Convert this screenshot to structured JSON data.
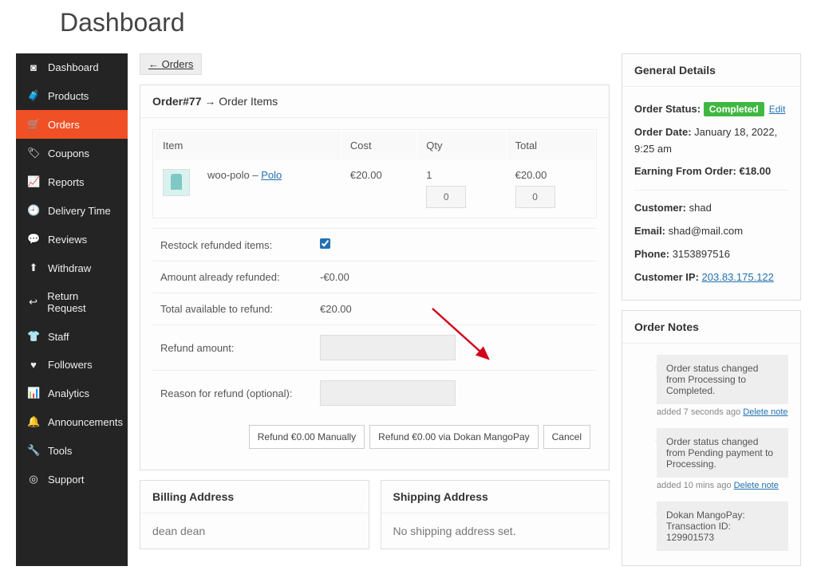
{
  "page_title": "Dashboard",
  "back_link": "← Orders",
  "sidebar": {
    "items": [
      {
        "label": "Dashboard",
        "icon": "◙"
      },
      {
        "label": "Products",
        "icon": "🧳"
      },
      {
        "label": "Orders",
        "icon": "🛒",
        "active": true
      },
      {
        "label": "Coupons",
        "icon": "🏷"
      },
      {
        "label": "Reports",
        "icon": "📈"
      },
      {
        "label": "Delivery Time",
        "icon": "🕘"
      },
      {
        "label": "Reviews",
        "icon": "💬"
      },
      {
        "label": "Withdraw",
        "icon": "⬆"
      },
      {
        "label": "Return Request",
        "icon": "↩"
      },
      {
        "label": "Staff",
        "icon": "👕"
      },
      {
        "label": "Followers",
        "icon": "♥"
      },
      {
        "label": "Analytics",
        "icon": "📊"
      },
      {
        "label": "Announcements",
        "icon": "🔔"
      },
      {
        "label": "Tools",
        "icon": "🔧"
      },
      {
        "label": "Support",
        "icon": "◎"
      }
    ]
  },
  "order": {
    "heading_prefix": "Order#77",
    "heading_suffix": " → Order Items",
    "columns": {
      "item": "Item",
      "cost": "Cost",
      "qty": "Qty",
      "total": "Total"
    },
    "line": {
      "name_prefix": "woo-polo – ",
      "name_link": "Polo",
      "cost": "€20.00",
      "qty": "1",
      "qty_refund_box": "0",
      "total": "€20.00",
      "total_refund_box": "0"
    },
    "refund": {
      "restock_label": "Restock refunded items:",
      "restock_checked": true,
      "already_label": "Amount already refunded:",
      "already_value": "-€0.00",
      "avail_label": "Total available to refund:",
      "avail_value": "€20.00",
      "amount_label": "Refund amount:",
      "reason_label": "Reason for refund (optional):"
    },
    "buttons": {
      "manual": "Refund €0.00 Manually",
      "via": "Refund €0.00 via Dokan MangoPay",
      "cancel": "Cancel"
    }
  },
  "addresses": {
    "billing_header": "Billing Address",
    "billing_body": "dean dean",
    "shipping_header": "Shipping Address",
    "shipping_body": "No shipping address set."
  },
  "general": {
    "header": "General Details",
    "status_label": "Order Status:",
    "status_pill": "Completed",
    "edit": "Edit",
    "date_label": "Order Date:",
    "date_value": "January 18, 2022, 9:25 am",
    "earning_label": "Earning From Order:",
    "earning_value": "€18.00",
    "customer_label": "Customer:",
    "customer_value": "shad",
    "email_label": "Email:",
    "email_value": "shad@mail.com",
    "phone_label": "Phone:",
    "phone_value": "3153897516",
    "ip_label": "Customer IP:",
    "ip_value": "203.83.175.122"
  },
  "notes": {
    "header": "Order Notes",
    "items": [
      {
        "text": "Order status changed from Processing to Completed.",
        "meta_prefix": "added 7 seconds ago ",
        "delete": "Delete note"
      },
      {
        "text": "Order status changed from Pending payment to Processing.",
        "meta_prefix": "added 10 mins ago ",
        "delete": "Delete note"
      },
      {
        "text": "Dokan MangoPay: Transaction ID: 129901573",
        "meta_prefix": "",
        "delete": ""
      }
    ]
  }
}
